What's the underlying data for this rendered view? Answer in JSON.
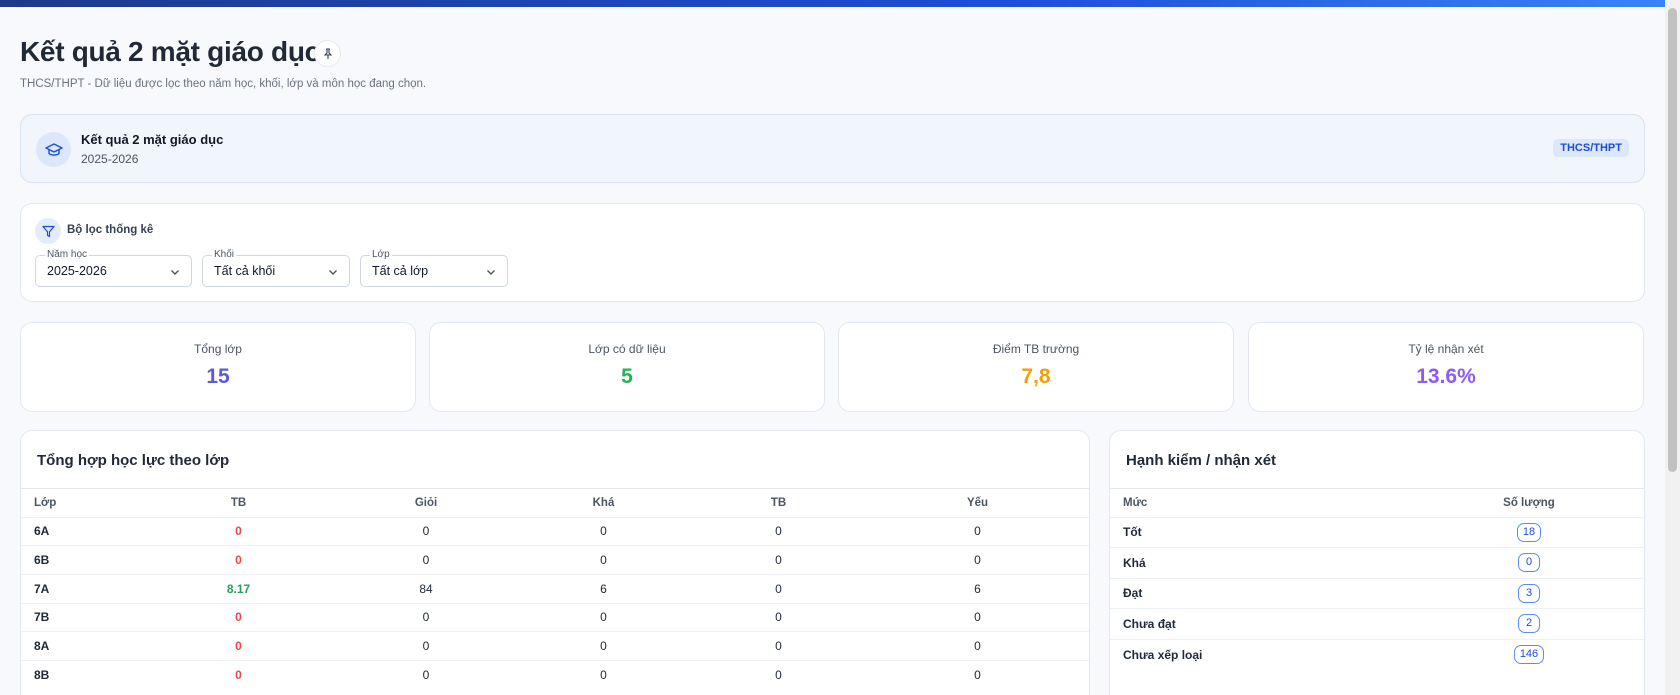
{
  "header": {
    "title": "Kết quả 2 mặt giáo dục",
    "pin_icon": "pin-icon",
    "subtitle": "THCS/THPT - Dữ liệu được lọc theo năm học, khối, lớp và môn học đang chọn."
  },
  "info_card": {
    "icon": "graduation-cap-icon",
    "title": "Kết quả 2 mặt giáo dục",
    "year": "2025-2026",
    "badge": "THCS/THPT"
  },
  "filters": {
    "icon": "filter-icon",
    "title": "Bộ lọc thống kê",
    "school_year": {
      "label": "Năm học",
      "value": "2025-2026"
    },
    "grade": {
      "label": "Khối",
      "value": "Tất cả khối"
    },
    "class": {
      "label": "Lớp",
      "value": "Tất cả lớp"
    }
  },
  "stats": [
    {
      "label": "Tổng lớp",
      "value": "15",
      "color": "#5b5bd6"
    },
    {
      "label": "Lớp có dữ liệu",
      "value": "5",
      "color": "#22b356"
    },
    {
      "label": "Điểm TB trường",
      "value": "7,8",
      "color": "#f59e0b"
    },
    {
      "label": "Tỷ lệ nhận xét",
      "value": "13.6%",
      "color": "#8b5cf6"
    }
  ],
  "academic_table": {
    "title": "Tổng hợp học lực theo lớp",
    "columns": [
      "Lớp",
      "TB",
      "Giỏi",
      "Khá",
      "TB",
      "Yếu"
    ],
    "rows": [
      [
        "6A",
        "0",
        "0",
        "0",
        "0",
        "0"
      ],
      [
        "6B",
        "0",
        "0",
        "0",
        "0",
        "0"
      ],
      [
        "7A",
        "8.17",
        "84",
        "6",
        "0",
        "6"
      ],
      [
        "7B",
        "0",
        "0",
        "0",
        "0",
        "0"
      ],
      [
        "8A",
        "0",
        "0",
        "0",
        "0",
        "0"
      ],
      [
        "8B",
        "0",
        "0",
        "0",
        "0",
        "0"
      ]
    ]
  },
  "conduct_table": {
    "title": "Hạnh kiểm / nhận xét",
    "columns": [
      "Mức",
      "Số lượng"
    ],
    "rows": [
      [
        "Tốt",
        "18"
      ],
      [
        "Khá",
        "0"
      ],
      [
        "Đạt",
        "3"
      ],
      [
        "Chưa đạt",
        "2"
      ],
      [
        "Chưa xếp loại",
        "146"
      ]
    ]
  }
}
